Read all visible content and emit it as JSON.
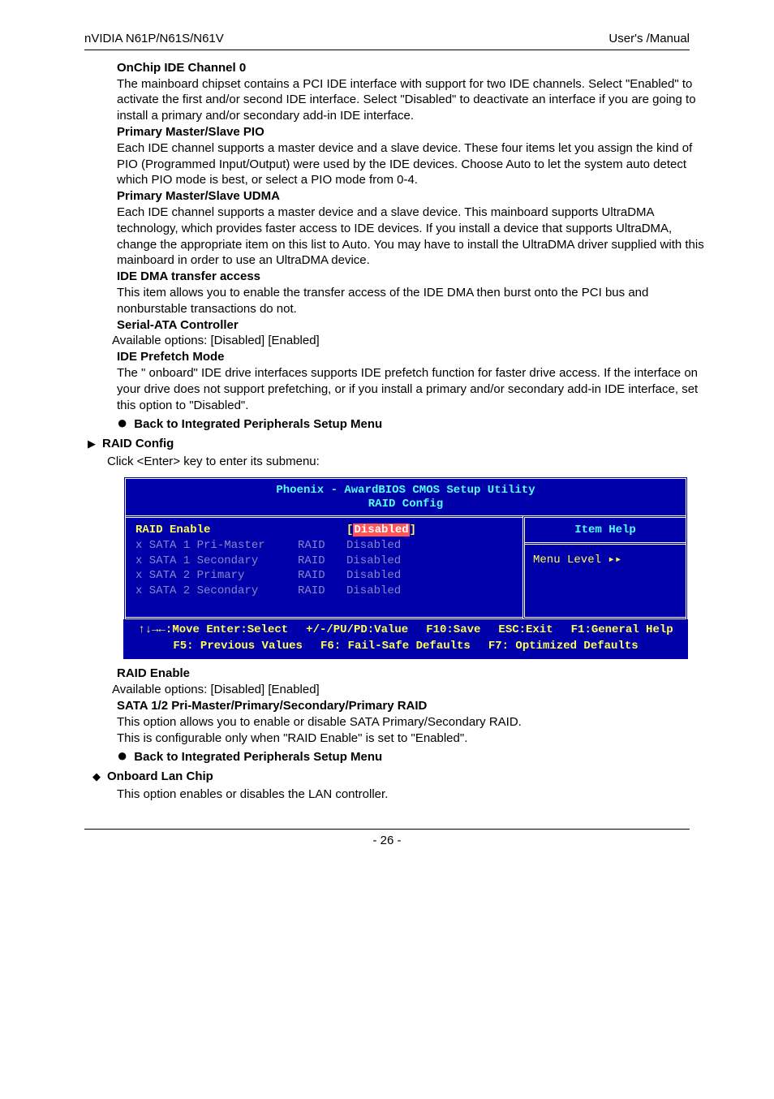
{
  "header": {
    "left": "nVIDIA N61P/N61S/N61V",
    "right": "User's /Manual"
  },
  "sections": {
    "onchip": {
      "title": "OnChip IDE Channel 0",
      "text": "The mainboard chipset contains a PCI IDE interface with support for two IDE channels. Select \"Enabled\" to activate the first and/or second IDE interface. Select \"Disabled\" to deactivate an interface if you are going to install a primary and/or secondary add-in IDE interface."
    },
    "pmspio": {
      "title": "Primary Master/Slave PIO",
      "text": "Each IDE channel supports a master device and a slave device. These four items let you assign the kind of PIO (Programmed Input/Output) were used by the IDE devices. Choose Auto to let the system auto detect which PIO mode is best, or select a PIO mode from 0-4."
    },
    "pmsudma": {
      "title": "Primary Master/Slave UDMA",
      "text": "Each IDE channel supports a master device and a slave device. This mainboard supports UltraDMA technology, which provides faster access to IDE devices. If you install a device that supports UltraDMA, change the appropriate item on this list to Auto. You may have to install the UltraDMA driver supplied with this mainboard in order to use an UltraDMA device."
    },
    "idedma": {
      "title": "IDE DMA transfer access",
      "text": "This item allows you to enable the transfer access of the IDE DMA then burst onto the PCI bus and nonburstable transactions do not."
    },
    "sata": {
      "title": "Serial-ATA Controller",
      "text": "Available options: [Disabled] [Enabled]"
    },
    "prefetch": {
      "title": "IDE Prefetch Mode",
      "text": "The \" onboard\" IDE drive interfaces supports IDE prefetch function for faster drive access. If the interface on your drive does not support prefetching, or if you install a primary and/or secondary add-in IDE interface, set this option to \"Disabled\"."
    },
    "back1": "Back to Integrated Peripherals Setup Menu",
    "raidcfg": {
      "title": "RAID Config",
      "sub": "Click <Enter> key to enter its submenu:"
    },
    "raidenable": {
      "title": "RAID Enable",
      "text": "Available options: [Disabled] [Enabled]"
    },
    "sataraid": {
      "title": "SATA 1/2 Pri-Master/Primary/Secondary/Primary RAID",
      "text1": "This option allows you to enable or disable SATA Primary/Secondary RAID.",
      "text2": "This is configurable only when \"RAID Enable\" is set to \"Enabled\"."
    },
    "back2": "Back to Integrated Peripherals Setup Menu",
    "onboardlan": {
      "title": "Onboard Lan Chip",
      "text": "This option enables or disables the LAN controller."
    }
  },
  "chart_data": {
    "type": "table",
    "title1": "Phoenix - AwardBIOS CMOS Setup Utility",
    "title2": "RAID Config",
    "rows": [
      {
        "x": "",
        "name": "RAID Enable",
        "mid": "",
        "val_pre": "[",
        "val": "Disabled",
        "val_post": "]",
        "highlight": true
      },
      {
        "x": "x",
        "name": "SATA 1 Pri-Master",
        "mid": "RAID",
        "val_pre": "",
        "val": "Disabled",
        "val_post": "",
        "highlight": false
      },
      {
        "x": "x",
        "name": "SATA 1 Secondary",
        "mid": "RAID",
        "val_pre": "",
        "val": "Disabled",
        "val_post": "",
        "highlight": false
      },
      {
        "x": "x",
        "name": "SATA 2 Primary",
        "mid": "RAID",
        "val_pre": "",
        "val": "Disabled",
        "val_post": "",
        "highlight": false
      },
      {
        "x": "x",
        "name": "SATA 2 Secondary",
        "mid": "RAID",
        "val_pre": "",
        "val": "Disabled",
        "val_post": "",
        "highlight": false
      }
    ],
    "itemhelp": "Item Help",
    "menulevel": "Menu Level  ▸▸",
    "foot": {
      "a": "↑↓→←:Move Enter:Select",
      "b": "+/-/PU/PD:Value",
      "c": "F10:Save",
      "d": "ESC:Exit",
      "e": "F1:General Help",
      "f": "F5: Previous Values",
      "g": "F6: Fail-Safe Defaults",
      "h": "F7: Optimized Defaults"
    }
  },
  "page": "- 26 -"
}
